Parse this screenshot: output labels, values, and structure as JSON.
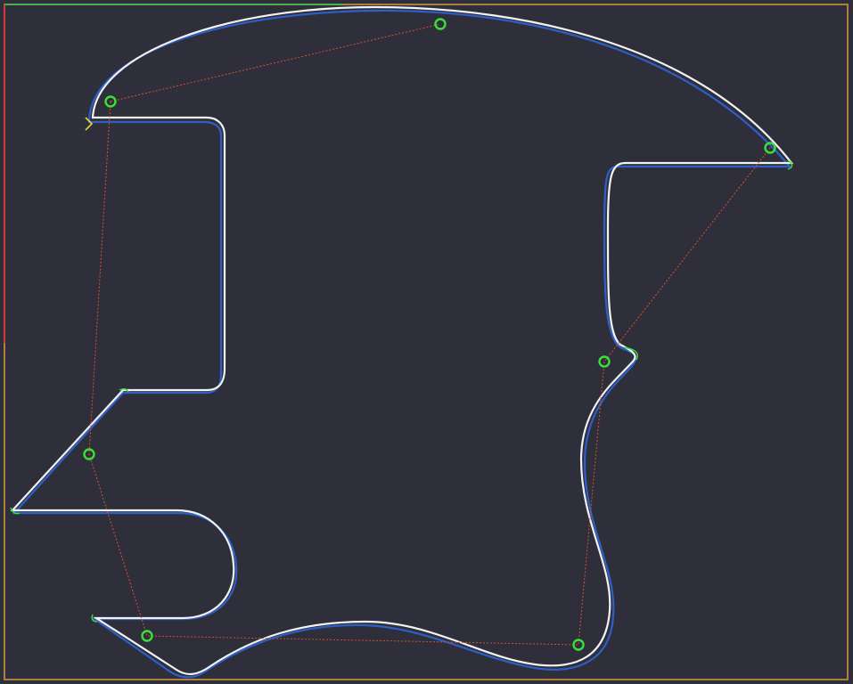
{
  "canvas": {
    "background_color": "#2e2f3a",
    "stock_boundary_color": "#c9953a",
    "x_axis_color": "#4caf50",
    "y_axis_color": "#d23a3a",
    "grid_color": "#3a3b47"
  },
  "toolpath": {
    "part_outline_color": "#f2f2f2",
    "offset_path_color": "#2e5fc7",
    "lead_marker_color": "#3adf3a",
    "rapid_move_color": "#d2552e",
    "tab_marker_color": "#3adf3a",
    "tab_count": 8
  },
  "icons": {
    "tab_marker": "circle-marker-icon",
    "start_point": "chevron-right-icon"
  }
}
